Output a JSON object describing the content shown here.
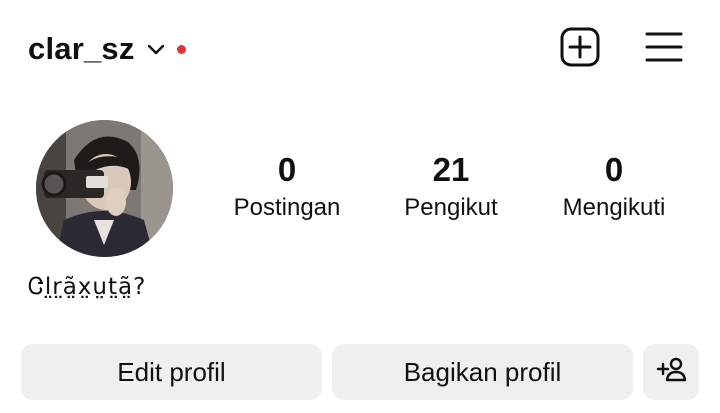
{
  "header": {
    "username": "clar_sz",
    "notification_dot_color": "#e0333a",
    "icons": [
      "chevron-down-icon",
      "create-plus-icon",
      "hamburger-menu-icon"
    ]
  },
  "profile": {
    "display_name": "Ꮳl̤r̤ã̤x̤ṳt̤ã̤?",
    "stats": [
      {
        "value": "0",
        "label": "Postingan"
      },
      {
        "value": "21",
        "label": "Pengikut"
      },
      {
        "value": "0",
        "label": "Mengikuti"
      }
    ]
  },
  "actions": {
    "edit_label": "Edit profil",
    "share_label": "Bagikan profil",
    "add_person_icon": "add-person-icon"
  }
}
